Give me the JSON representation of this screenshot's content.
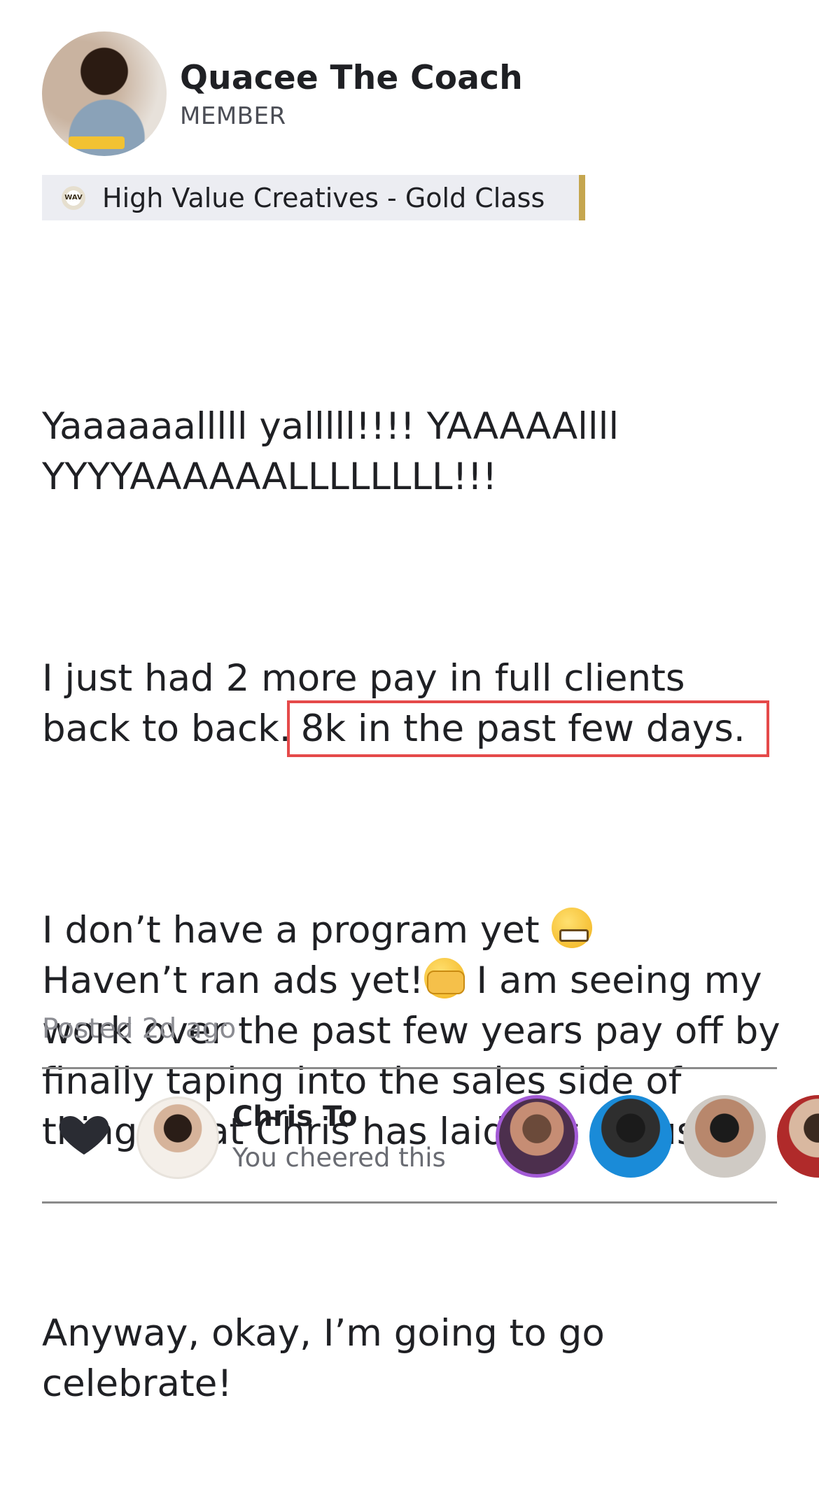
{
  "author": {
    "name": "Quacee The Coach",
    "role": "MEMBER"
  },
  "group": {
    "logo_text": "WAV",
    "label": "High Value Creatives - Gold Class"
  },
  "post": {
    "line1": "Yaaaaaalllll yalllll!!!! YAAAAAllll",
    "line2": "YYYYAAAAAALLLLLLLL!!!",
    "p2_start": "I just had 2 more pay in full clients back to back.",
    "p2_highlight": "8k in the past few days.",
    "p3_a": "I don’t have a program yet ",
    "p3_b": "Haven’t ran ads yet!",
    "p3_c": " I am seeing my work over the past few years pay off by finally taping into the sales side of things that Chris has laid out for us!",
    "p4": "Anyway, okay, I’m going to go celebrate!",
    "posted": "Posted 2d ago"
  },
  "cheer": {
    "name": "Chris To",
    "status": "You cheered this"
  },
  "colors": {
    "highlight_border": "#e54a4a",
    "chip_accent": "#c5a64f"
  }
}
